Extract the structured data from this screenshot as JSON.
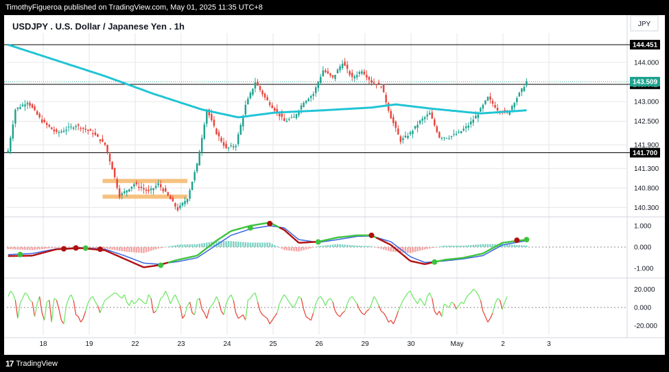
{
  "header": {
    "published_line": "TimothyFigueroa published on TradingView.com, May 01, 2025 11:35 UTC+8"
  },
  "footer": {
    "logo_text": "TradingView"
  },
  "colors": {
    "up": "#1fa28f",
    "down": "#e8453c",
    "sma": "#20c4d4",
    "zone": "#f5b66a",
    "macd_fast": "#3ec23e",
    "macd_slow": "#3a63e0",
    "macd_cross_down": "#b01010",
    "osc_up": "#73e86a",
    "osc_down": "#e74a3c",
    "grid": "#e6e6e6",
    "text": "#131722"
  },
  "chart_data": {
    "type": "candlestick",
    "title": "USDJPY . U.S. Dollar / Japanese Yen . 1h",
    "currency_label": "JPY",
    "price_ticks": [
      "144.000",
      "143.000",
      "142.500",
      "141.900",
      "141.300",
      "140.800",
      "140.300"
    ],
    "horizontal_levels": [
      {
        "value": 144.451,
        "label": "144.451"
      },
      {
        "value": 143.442,
        "label": "143.442"
      },
      {
        "value": 141.7,
        "label": "141.700"
      }
    ],
    "last_price": {
      "value": 143.509,
      "label": "143.509"
    },
    "x_tick_labels": [
      "18",
      "19",
      "22",
      "23",
      "24",
      "25",
      "26",
      "29",
      "30",
      "May",
      "2",
      "3"
    ],
    "price_range": [
      140.1,
      144.75
    ],
    "key_price_path": [
      {
        "i": 0,
        "p": 141.75
      },
      {
        "i": 3,
        "p": 142.8
      },
      {
        "i": 8,
        "p": 143.0
      },
      {
        "i": 14,
        "p": 142.5
      },
      {
        "i": 20,
        "p": 142.2
      },
      {
        "i": 28,
        "p": 142.4
      },
      {
        "i": 35,
        "p": 142.2
      },
      {
        "i": 40,
        "p": 141.9
      },
      {
        "i": 43,
        "p": 141.3
      },
      {
        "i": 46,
        "p": 140.6
      },
      {
        "i": 52,
        "p": 140.9
      },
      {
        "i": 58,
        "p": 140.7
      },
      {
        "i": 62,
        "p": 140.9
      },
      {
        "i": 66,
        "p": 140.6
      },
      {
        "i": 70,
        "p": 140.25
      },
      {
        "i": 74,
        "p": 140.55
      },
      {
        "i": 78,
        "p": 141.4
      },
      {
        "i": 82,
        "p": 142.8
      },
      {
        "i": 86,
        "p": 142.2
      },
      {
        "i": 90,
        "p": 141.8
      },
      {
        "i": 94,
        "p": 141.9
      },
      {
        "i": 98,
        "p": 142.9
      },
      {
        "i": 102,
        "p": 143.5
      },
      {
        "i": 106,
        "p": 143.1
      },
      {
        "i": 110,
        "p": 142.8
      },
      {
        "i": 114,
        "p": 142.5
      },
      {
        "i": 118,
        "p": 142.6
      },
      {
        "i": 122,
        "p": 143.0
      },
      {
        "i": 126,
        "p": 143.2
      },
      {
        "i": 130,
        "p": 143.8
      },
      {
        "i": 134,
        "p": 143.6
      },
      {
        "i": 138,
        "p": 144.0
      },
      {
        "i": 142,
        "p": 143.6
      },
      {
        "i": 146,
        "p": 143.8
      },
      {
        "i": 150,
        "p": 143.5
      },
      {
        "i": 154,
        "p": 143.4
      },
      {
        "i": 158,
        "p": 142.6
      },
      {
        "i": 162,
        "p": 142.0
      },
      {
        "i": 166,
        "p": 142.2
      },
      {
        "i": 170,
        "p": 142.5
      },
      {
        "i": 174,
        "p": 142.7
      },
      {
        "i": 178,
        "p": 142.1
      },
      {
        "i": 182,
        "p": 142.1
      },
      {
        "i": 186,
        "p": 142.2
      },
      {
        "i": 190,
        "p": 142.4
      },
      {
        "i": 194,
        "p": 142.7
      },
      {
        "i": 198,
        "p": 143.1
      },
      {
        "i": 202,
        "p": 142.8
      },
      {
        "i": 206,
        "p": 142.7
      },
      {
        "i": 210,
        "p": 143.1
      },
      {
        "i": 214,
        "p": 143.509
      }
    ],
    "sma_path": [
      {
        "i": 0,
        "p": 144.45
      },
      {
        "i": 20,
        "p": 144.05
      },
      {
        "i": 40,
        "p": 143.65
      },
      {
        "i": 60,
        "p": 143.2
      },
      {
        "i": 80,
        "p": 142.8
      },
      {
        "i": 95,
        "p": 142.6
      },
      {
        "i": 110,
        "p": 142.72
      },
      {
        "i": 130,
        "p": 142.78
      },
      {
        "i": 150,
        "p": 142.85
      },
      {
        "i": 160,
        "p": 142.93
      },
      {
        "i": 175,
        "p": 142.82
      },
      {
        "i": 195,
        "p": 142.7
      },
      {
        "i": 214,
        "p": 142.78
      }
    ],
    "consolidation_zone": {
      "i_start": 40,
      "i_end": 74,
      "top": 140.98,
      "bottom": 140.58
    },
    "macd": {
      "ticks": [
        "1.000",
        "0.000",
        "-1.000"
      ],
      "range": [
        -1.35,
        1.35
      ],
      "fast_path": [
        {
          "i": 0,
          "p": -0.42
        },
        {
          "i": 10,
          "p": -0.4
        },
        {
          "i": 20,
          "p": -0.1
        },
        {
          "i": 30,
          "p": -0.05
        },
        {
          "i": 40,
          "p": -0.15
        },
        {
          "i": 48,
          "p": -0.55
        },
        {
          "i": 56,
          "p": -0.95
        },
        {
          "i": 62,
          "p": -0.85
        },
        {
          "i": 70,
          "p": -0.6
        },
        {
          "i": 78,
          "p": -0.4
        },
        {
          "i": 86,
          "p": 0.3
        },
        {
          "i": 92,
          "p": 0.75
        },
        {
          "i": 100,
          "p": 1.0
        },
        {
          "i": 108,
          "p": 1.15
        },
        {
          "i": 114,
          "p": 0.8
        },
        {
          "i": 120,
          "p": 0.2
        },
        {
          "i": 128,
          "p": 0.25
        },
        {
          "i": 136,
          "p": 0.45
        },
        {
          "i": 144,
          "p": 0.55
        },
        {
          "i": 150,
          "p": 0.55
        },
        {
          "i": 158,
          "p": 0.1
        },
        {
          "i": 166,
          "p": -0.65
        },
        {
          "i": 172,
          "p": -0.8
        },
        {
          "i": 180,
          "p": -0.6
        },
        {
          "i": 188,
          "p": -0.5
        },
        {
          "i": 196,
          "p": -0.3
        },
        {
          "i": 204,
          "p": 0.2
        },
        {
          "i": 214,
          "p": 0.35
        }
      ],
      "slow_path": [
        {
          "i": 0,
          "p": -0.35
        },
        {
          "i": 10,
          "p": -0.3
        },
        {
          "i": 20,
          "p": -0.08
        },
        {
          "i": 30,
          "p": -0.03
        },
        {
          "i": 40,
          "p": -0.1
        },
        {
          "i": 48,
          "p": -0.4
        },
        {
          "i": 56,
          "p": -0.75
        },
        {
          "i": 62,
          "p": -0.8
        },
        {
          "i": 70,
          "p": -0.68
        },
        {
          "i": 78,
          "p": -0.5
        },
        {
          "i": 86,
          "p": 0.1
        },
        {
          "i": 92,
          "p": 0.55
        },
        {
          "i": 100,
          "p": 0.85
        },
        {
          "i": 108,
          "p": 1.0
        },
        {
          "i": 114,
          "p": 0.9
        },
        {
          "i": 120,
          "p": 0.35
        },
        {
          "i": 128,
          "p": 0.22
        },
        {
          "i": 136,
          "p": 0.35
        },
        {
          "i": 144,
          "p": 0.5
        },
        {
          "i": 150,
          "p": 0.52
        },
        {
          "i": 158,
          "p": 0.25
        },
        {
          "i": 166,
          "p": -0.45
        },
        {
          "i": 172,
          "p": -0.72
        },
        {
          "i": 180,
          "p": -0.65
        },
        {
          "i": 188,
          "p": -0.55
        },
        {
          "i": 196,
          "p": -0.4
        },
        {
          "i": 204,
          "p": 0.1
        },
        {
          "i": 214,
          "p": 0.3
        }
      ],
      "cross_markers": [
        {
          "i": 5,
          "p": -0.35,
          "kind": "up"
        },
        {
          "i": 23,
          "p": -0.08,
          "kind": "down"
        },
        {
          "i": 28,
          "p": -0.04,
          "kind": "down"
        },
        {
          "i": 32,
          "p": -0.05,
          "kind": "up"
        },
        {
          "i": 38,
          "p": -0.1,
          "kind": "down"
        },
        {
          "i": 63,
          "p": -0.85,
          "kind": "up"
        },
        {
          "i": 100,
          "p": 0.9,
          "kind": "up"
        },
        {
          "i": 108,
          "p": 1.1,
          "kind": "down"
        },
        {
          "i": 128,
          "p": 0.24,
          "kind": "up"
        },
        {
          "i": 150,
          "p": 0.55,
          "kind": "down"
        },
        {
          "i": 176,
          "p": -0.7,
          "kind": "up"
        },
        {
          "i": 210,
          "p": 0.32,
          "kind": "down"
        },
        {
          "i": 214,
          "p": 0.35,
          "kind": "up"
        }
      ]
    },
    "oscillator": {
      "ticks": [
        "20.000",
        "0.000",
        "-20.000"
      ],
      "range": [
        -30,
        30
      ],
      "values": [
        12,
        18,
        15,
        8,
        -12,
        5,
        10,
        16,
        14,
        8,
        6,
        -10,
        4,
        12,
        -6,
        -14,
        6,
        8,
        -16,
        10,
        8,
        -2,
        -14,
        -18,
        2,
        10,
        14,
        8,
        -8,
        -10,
        -16,
        -12,
        -4,
        5,
        10,
        12,
        6,
        2,
        -6,
        2,
        8,
        10,
        12,
        14,
        16,
        15,
        12,
        10,
        14,
        6,
        2,
        8,
        4,
        6,
        10,
        8,
        5,
        4,
        14,
        10,
        -6,
        -4,
        2,
        10,
        12,
        18,
        12,
        4,
        10,
        14,
        8,
        2,
        -12,
        -8,
        2,
        6,
        -6,
        -8,
        8,
        10,
        -2,
        -6,
        -12,
        -2,
        2,
        6,
        12,
        6,
        -4,
        -8,
        4,
        10,
        14,
        8,
        -6,
        -12,
        -10,
        -8,
        -14,
        8,
        10,
        14,
        16,
        6,
        -4,
        -8,
        -10,
        -12,
        -18,
        -14,
        -10,
        -6,
        4,
        10,
        14,
        10,
        6,
        2,
        0,
        6,
        12,
        10,
        -2,
        -10,
        -12,
        -14,
        -6,
        4,
        10,
        12,
        8,
        2,
        8,
        10,
        6,
        -4,
        -8,
        -10,
        -6,
        -4,
        4,
        10,
        12,
        8,
        4,
        -2,
        -6,
        -8,
        -4,
        -2,
        4,
        12,
        8,
        2,
        -4,
        -6,
        -10,
        -16,
        -14,
        -18,
        -12,
        -4,
        2,
        8,
        12,
        16,
        18,
        12,
        8,
        4,
        10,
        6,
        2,
        12,
        16,
        10,
        -4,
        -8,
        -4,
        -10,
        4,
        2,
        0,
        6,
        4,
        -2,
        2,
        6,
        4,
        10,
        14,
        16,
        20,
        18,
        14,
        8,
        -4,
        -10,
        -16,
        -12,
        -6,
        4,
        10,
        8,
        -2,
        6,
        12
      ]
    }
  }
}
